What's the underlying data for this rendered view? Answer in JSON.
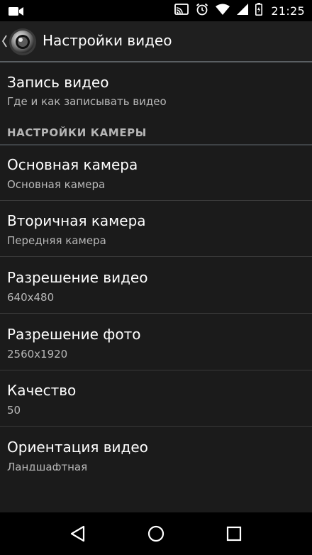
{
  "status_bar": {
    "time": "21:25",
    "icons": [
      "video-camera-icon",
      "cast-icon",
      "alarm-icon",
      "wifi-icon",
      "signal-icon",
      "battery-icon"
    ]
  },
  "action_bar": {
    "title": "Настройки видео",
    "icons": [
      "up-chevron-icon",
      "app-logo-icon"
    ]
  },
  "preferences": {
    "record": {
      "title": "Запись видео",
      "summary": "Где и как записывать видео"
    },
    "category_camera": "НАСТРОЙКИ КАМЕРЫ",
    "items": [
      {
        "title": "Основная камера",
        "summary": "Основная камера"
      },
      {
        "title": "Вторичная камера",
        "summary": "Передняя камера"
      },
      {
        "title": "Разрешение видео",
        "summary": "640x480"
      },
      {
        "title": "Разрешение фото",
        "summary": "2560x1920"
      },
      {
        "title": "Качество",
        "summary": "50"
      },
      {
        "title": "Ориентация видео",
        "summary": "Ландшафтная"
      }
    ]
  },
  "nav_bar": {
    "icons": [
      "back-icon",
      "home-icon",
      "recents-icon"
    ]
  },
  "colors": {
    "background": "#1b1b1b",
    "action_bar": "#1f1f1f",
    "divider": "#3a3a3a",
    "summary_text": "#b8b8b8"
  }
}
